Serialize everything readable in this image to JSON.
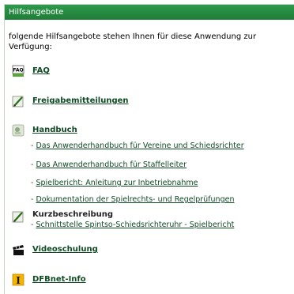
{
  "header": {
    "title": "Hilfsangebote"
  },
  "intro": "folgende Hilfsangebote stehen Ihnen für diese Anwendung zur Verfügung:",
  "entries": {
    "faq": {
      "label": "FAQ",
      "icon": "faq-icon"
    },
    "freigabe": {
      "label": "Freigabemitteilungen",
      "icon": "pencil-document-icon"
    },
    "handbuch": {
      "label": "Handbuch",
      "icon": "handbook-icon",
      "links": [
        "Das Anwenderhandbuch für Vereine und Schiedsrichter",
        "Das Anwenderhandbuch für Staffelleiter",
        "Spielbericht: Anleitung zur Inbetriebnahme",
        "Dokumentation der Spielrechts- und Regelprüfungen"
      ]
    },
    "kurz": {
      "label": "Kurzbeschreibung",
      "icon": "pencil-document-icon",
      "links": [
        "Schnittstelle Spintso-Schiedsrichteruhr - Spielbericht"
      ]
    },
    "video": {
      "label": "Videoschulung",
      "icon": "clapperboard-icon"
    },
    "dfbnet": {
      "label": "DFBnet-Info",
      "icon": "info-i-icon"
    }
  },
  "dash": "-",
  "colors": {
    "header": "#268c42",
    "link": "#0e4a23"
  }
}
